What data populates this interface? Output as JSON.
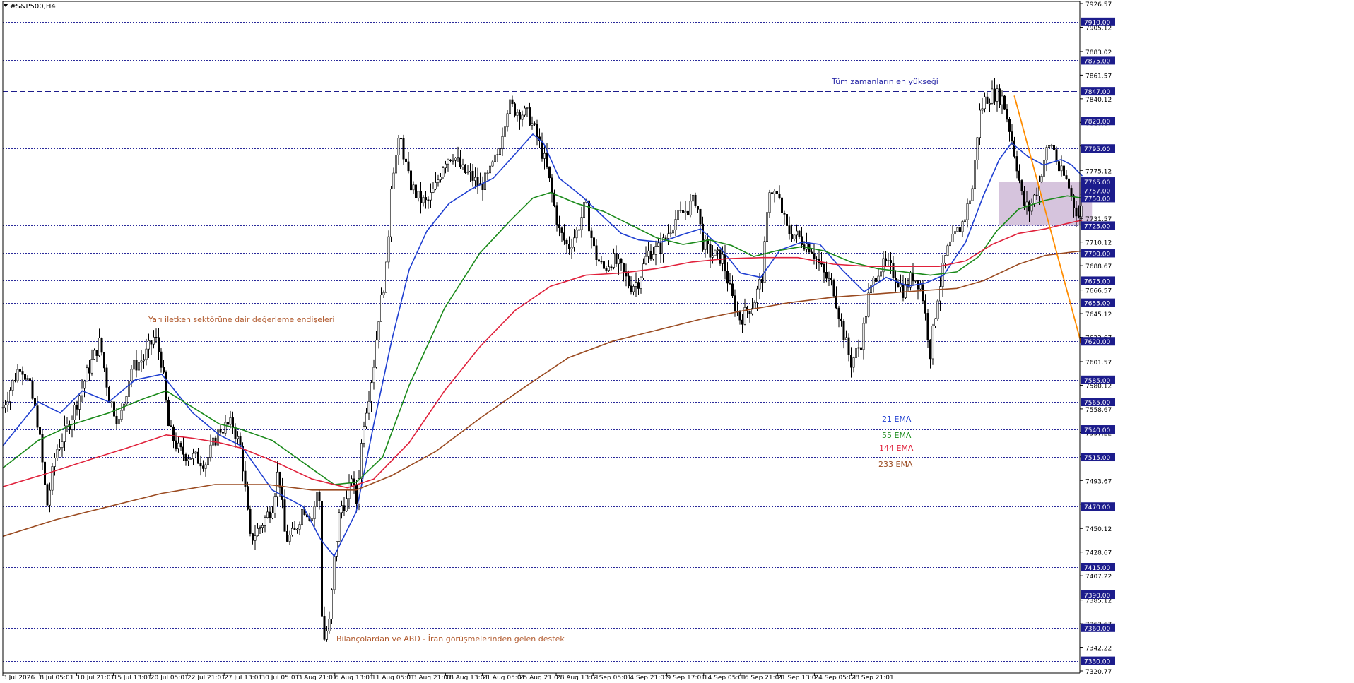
{
  "header": {
    "symbol": "#S&P500,H4"
  },
  "chart_data": {
    "type": "candlestick",
    "symbol": "#S&P500,H4",
    "ylim": [
      7320.77,
      7926.57
    ],
    "x_tick_labels": [
      "3 Jul 2026",
      "8 Jul 05:01",
      "10 Jul 21:01",
      "15 Jul 13:01",
      "20 Jul 05:01",
      "22 Jul 21:01",
      "27 Jul 13:01",
      "30 Jul 05:01",
      "3 Aug 21:01",
      "6 Aug 13:01",
      "11 Aug 05:01",
      "13 Aug 21:01",
      "18 Aug 13:01",
      "21 Aug 05:01",
      "25 Aug 21:01",
      "28 Aug 13:01",
      "2 Sep 05:01",
      "4 Sep 21:01",
      "9 Sep 17:01",
      "14 Sep 05:01",
      "16 Sep 21:01",
      "21 Sep 13:01",
      "24 Sep 05:01",
      "28 Sep 21:01"
    ],
    "y_tick_labels": [
      "7926.57",
      "7905.12",
      "7883.02",
      "7861.57",
      "7840.12",
      "7818.67",
      "7797.22",
      "7775.12",
      "7753.67",
      "7731.57",
      "7710.12",
      "7688.67",
      "7666.57",
      "7645.12",
      "7623.67",
      "7601.57",
      "7580.12",
      "7558.67",
      "7537.22",
      "7515.12",
      "7493.67",
      "7472.22",
      "7450.12",
      "7428.67",
      "7407.22",
      "7385.12",
      "7363.67",
      "7342.22",
      "7320.77"
    ],
    "horizontal_levels": [
      "7910.00",
      "7875.00",
      "7847.00",
      "7820.00",
      "7795.00",
      "7765.00",
      "7757.00",
      "7750.00",
      "7725.00",
      "7700.00",
      "7675.00",
      "7655.00",
      "7620.00",
      "7585.00",
      "7565.00",
      "7540.00",
      "7515.00",
      "7470.00",
      "7415.00",
      "7390.00",
      "7360.00",
      "7330.00"
    ],
    "all_time_high_level": 7847,
    "ema_legend": [
      {
        "label": "21 EMA",
        "color": "#1f3fd1"
      },
      {
        "label": "55 EMA",
        "color": "#1a8a1a"
      },
      {
        "label": "144 EMA",
        "color": "#e0203a"
      },
      {
        "label": "233 EMA",
        "color": "#9a4a20"
      }
    ],
    "annotations": {
      "ath": "Tüm zamanların en yükseği",
      "semis": "Yarı iletken sektörüne dair değerleme endişeleri",
      "support": "Bilançolardan ve ABD - İran görüşmelerinden gelen destek"
    },
    "price_path": [
      [
        0,
        7560
      ],
      [
        20,
        7600
      ],
      [
        30,
        7580
      ],
      [
        40,
        7545
      ],
      [
        50,
        7470
      ],
      [
        60,
        7520
      ],
      [
        75,
        7545
      ],
      [
        95,
        7590
      ],
      [
        110,
        7620
      ],
      [
        120,
        7570
      ],
      [
        132,
        7545
      ],
      [
        145,
        7595
      ],
      [
        160,
        7605
      ],
      [
        172,
        7625
      ],
      [
        180,
        7600
      ],
      [
        188,
        7540
      ],
      [
        200,
        7520
      ],
      [
        215,
        7515
      ],
      [
        230,
        7510
      ],
      [
        245,
        7540
      ],
      [
        260,
        7545
      ],
      [
        270,
        7520
      ],
      [
        280,
        7440
      ],
      [
        290,
        7450
      ],
      [
        305,
        7470
      ],
      [
        312,
        7505
      ],
      [
        320,
        7440
      ],
      [
        330,
        7445
      ],
      [
        340,
        7470
      ],
      [
        350,
        7460
      ],
      [
        358,
        7490
      ],
      [
        362,
        7345
      ],
      [
        370,
        7365
      ],
      [
        375,
        7420
      ],
      [
        382,
        7470
      ],
      [
        390,
        7475
      ],
      [
        395,
        7500
      ],
      [
        400,
        7470
      ],
      [
        408,
        7545
      ],
      [
        415,
        7575
      ],
      [
        420,
        7600
      ],
      [
        425,
        7640
      ],
      [
        435,
        7690
      ],
      [
        440,
        7770
      ],
      [
        450,
        7805
      ],
      [
        460,
        7765
      ],
      [
        470,
        7750
      ],
      [
        480,
        7745
      ],
      [
        490,
        7760
      ],
      [
        500,
        7785
      ],
      [
        510,
        7790
      ],
      [
        520,
        7775
      ],
      [
        530,
        7770
      ],
      [
        540,
        7760
      ],
      [
        550,
        7770
      ],
      [
        560,
        7790
      ],
      [
        572,
        7835
      ],
      [
        580,
        7830
      ],
      [
        595,
        7825
      ],
      [
        605,
        7805
      ],
      [
        615,
        7780
      ],
      [
        625,
        7740
      ],
      [
        630,
        7720
      ],
      [
        640,
        7705
      ],
      [
        650,
        7720
      ],
      [
        660,
        7745
      ],
      [
        665,
        7720
      ],
      [
        670,
        7700
      ],
      [
        680,
        7685
      ],
      [
        690,
        7695
      ],
      [
        700,
        7685
      ],
      [
        710,
        7670
      ],
      [
        720,
        7675
      ],
      [
        730,
        7700
      ],
      [
        745,
        7705
      ],
      [
        760,
        7730
      ],
      [
        775,
        7740
      ],
      [
        785,
        7750
      ],
      [
        792,
        7710
      ],
      [
        800,
        7700
      ],
      [
        815,
        7695
      ],
      [
        825,
        7660
      ],
      [
        835,
        7640
      ],
      [
        850,
        7655
      ],
      [
        860,
        7680
      ],
      [
        868,
        7760
      ],
      [
        878,
        7750
      ],
      [
        888,
        7720
      ],
      [
        900,
        7715
      ],
      [
        915,
        7705
      ],
      [
        930,
        7680
      ],
      [
        940,
        7670
      ],
      [
        948,
        7640
      ],
      [
        960,
        7600
      ],
      [
        972,
        7620
      ],
      [
        980,
        7660
      ],
      [
        990,
        7685
      ],
      [
        1000,
        7690
      ],
      [
        1010,
        7680
      ],
      [
        1020,
        7665
      ],
      [
        1030,
        7680
      ],
      [
        1040,
        7670
      ],
      [
        1050,
        7610
      ],
      [
        1058,
        7660
      ],
      [
        1068,
        7700
      ],
      [
        1078,
        7715
      ],
      [
        1088,
        7730
      ],
      [
        1098,
        7760
      ],
      [
        1105,
        7825
      ],
      [
        1112,
        7840
      ],
      [
        1122,
        7845
      ],
      [
        1132,
        7840
      ],
      [
        1142,
        7805
      ],
      [
        1148,
        7780
      ],
      [
        1155,
        7745
      ],
      [
        1162,
        7740
      ],
      [
        1172,
        7760
      ],
      [
        1180,
        7790
      ],
      [
        1188,
        7800
      ],
      [
        1196,
        7775
      ],
      [
        1205,
        7765
      ],
      [
        1212,
        7745
      ],
      [
        1220,
        7730
      ],
      [
        1222,
        7755
      ]
    ],
    "series": [
      {
        "name": "21 EMA",
        "color": "#1f3fd1",
        "points": [
          [
            0,
            7525
          ],
          [
            40,
            7565
          ],
          [
            65,
            7555
          ],
          [
            90,
            7575
          ],
          [
            120,
            7565
          ],
          [
            150,
            7585
          ],
          [
            180,
            7590
          ],
          [
            215,
            7555
          ],
          [
            245,
            7535
          ],
          [
            270,
            7525
          ],
          [
            305,
            7485
          ],
          [
            340,
            7470
          ],
          [
            360,
            7440
          ],
          [
            375,
            7425
          ],
          [
            400,
            7465
          ],
          [
            420,
            7545
          ],
          [
            440,
            7620
          ],
          [
            460,
            7685
          ],
          [
            480,
            7720
          ],
          [
            505,
            7745
          ],
          [
            530,
            7758
          ],
          [
            555,
            7768
          ],
          [
            580,
            7790
          ],
          [
            600,
            7808
          ],
          [
            612,
            7800
          ],
          [
            630,
            7768
          ],
          [
            655,
            7752
          ],
          [
            680,
            7733
          ],
          [
            700,
            7718
          ],
          [
            720,
            7712
          ],
          [
            745,
            7710
          ],
          [
            770,
            7717
          ],
          [
            790,
            7722
          ],
          [
            810,
            7707
          ],
          [
            835,
            7682
          ],
          [
            858,
            7678
          ],
          [
            880,
            7703
          ],
          [
            905,
            7710
          ],
          [
            925,
            7708
          ],
          [
            950,
            7685
          ],
          [
            975,
            7665
          ],
          [
            1000,
            7678
          ],
          [
            1025,
            7670
          ],
          [
            1045,
            7673
          ],
          [
            1065,
            7680
          ],
          [
            1090,
            7710
          ],
          [
            1110,
            7752
          ],
          [
            1128,
            7785
          ],
          [
            1142,
            7800
          ],
          [
            1160,
            7788
          ],
          [
            1178,
            7780
          ],
          [
            1198,
            7785
          ],
          [
            1210,
            7780
          ],
          [
            1222,
            7770
          ]
        ]
      },
      {
        "name": "55 EMA",
        "color": "#1a8a1a",
        "points": [
          [
            0,
            7505
          ],
          [
            40,
            7530
          ],
          [
            80,
            7545
          ],
          [
            120,
            7555
          ],
          [
            160,
            7568
          ],
          [
            185,
            7575
          ],
          [
            215,
            7560
          ],
          [
            245,
            7545
          ],
          [
            270,
            7540
          ],
          [
            305,
            7530
          ],
          [
            340,
            7510
          ],
          [
            375,
            7490
          ],
          [
            400,
            7492
          ],
          [
            430,
            7515
          ],
          [
            460,
            7580
          ],
          [
            500,
            7650
          ],
          [
            540,
            7700
          ],
          [
            575,
            7730
          ],
          [
            600,
            7750
          ],
          [
            620,
            7755
          ],
          [
            650,
            7745
          ],
          [
            680,
            7738
          ],
          [
            710,
            7726
          ],
          [
            740,
            7714
          ],
          [
            770,
            7708
          ],
          [
            800,
            7712
          ],
          [
            825,
            7707
          ],
          [
            850,
            7697
          ],
          [
            875,
            7702
          ],
          [
            905,
            7706
          ],
          [
            930,
            7702
          ],
          [
            960,
            7692
          ],
          [
            990,
            7686
          ],
          [
            1020,
            7683
          ],
          [
            1050,
            7680
          ],
          [
            1080,
            7683
          ],
          [
            1105,
            7697
          ],
          [
            1125,
            7720
          ],
          [
            1150,
            7740
          ],
          [
            1180,
            7748
          ],
          [
            1205,
            7752
          ],
          [
            1222,
            7750
          ]
        ]
      },
      {
        "name": "144 EMA",
        "color": "#e0203a",
        "points": [
          [
            0,
            7488
          ],
          [
            50,
            7500
          ],
          [
            100,
            7513
          ],
          [
            140,
            7523
          ],
          [
            185,
            7535
          ],
          [
            215,
            7532
          ],
          [
            245,
            7528
          ],
          [
            270,
            7523
          ],
          [
            310,
            7510
          ],
          [
            350,
            7495
          ],
          [
            390,
            7487
          ],
          [
            420,
            7495
          ],
          [
            460,
            7528
          ],
          [
            500,
            7575
          ],
          [
            540,
            7615
          ],
          [
            580,
            7648
          ],
          [
            620,
            7670
          ],
          [
            660,
            7680
          ],
          [
            700,
            7682
          ],
          [
            740,
            7686
          ],
          [
            780,
            7692
          ],
          [
            820,
            7695
          ],
          [
            860,
            7696
          ],
          [
            900,
            7696
          ],
          [
            940,
            7690
          ],
          [
            980,
            7688
          ],
          [
            1020,
            7688
          ],
          [
            1060,
            7688
          ],
          [
            1090,
            7693
          ],
          [
            1120,
            7708
          ],
          [
            1150,
            7718
          ],
          [
            1180,
            7722
          ],
          [
            1205,
            7727
          ],
          [
            1222,
            7730
          ]
        ]
      },
      {
        "name": "233 EMA",
        "color": "#9a4a20",
        "points": [
          [
            0,
            7443
          ],
          [
            60,
            7458
          ],
          [
            120,
            7470
          ],
          [
            180,
            7482
          ],
          [
            240,
            7490
          ],
          [
            300,
            7490
          ],
          [
            350,
            7485
          ],
          [
            400,
            7485
          ],
          [
            440,
            7498
          ],
          [
            490,
            7520
          ],
          [
            540,
            7550
          ],
          [
            590,
            7578
          ],
          [
            640,
            7605
          ],
          [
            690,
            7620
          ],
          [
            740,
            7630
          ],
          [
            790,
            7640
          ],
          [
            840,
            7648
          ],
          [
            890,
            7655
          ],
          [
            940,
            7660
          ],
          [
            990,
            7663
          ],
          [
            1040,
            7666
          ],
          [
            1080,
            7668
          ],
          [
            1110,
            7675
          ],
          [
            1150,
            7690
          ],
          [
            1180,
            7698
          ],
          [
            1210,
            7701
          ],
          [
            1222,
            7702
          ]
        ]
      }
    ],
    "trendline": {
      "x": [
        1145,
        1530
      ],
      "y": [
        7843,
        7618
      ],
      "color": "#ff8c00"
    },
    "consolidation_box": {
      "x": [
        1128,
        1233
      ],
      "y": [
        7725,
        7765
      ]
    },
    "grid": false
  }
}
